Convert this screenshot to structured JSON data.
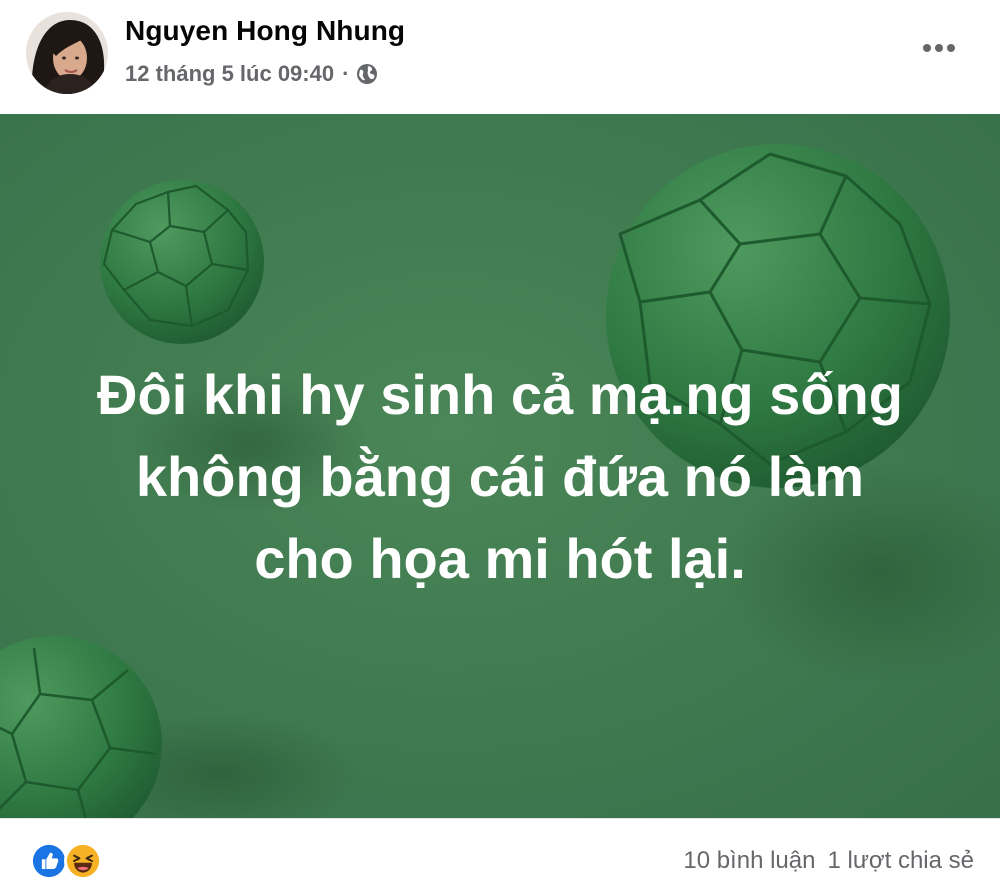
{
  "post": {
    "author": "Nguyen Hong Nhung",
    "timestamp": "12 tháng 5 lúc 09:40",
    "separator": "·",
    "audience_icon": "globe-icon",
    "more_icon": "more-options-icon",
    "image_text_lines": [
      "Đôi khi hy sinh cả mạ.ng sống",
      "không bằng cái đứa nó làm",
      "cho họa mi hót lại."
    ],
    "image_background_color": "#3f7a4e"
  },
  "footer": {
    "reaction_icons": [
      "like-icon",
      "haha-icon"
    ],
    "comments": "10 bình luận",
    "shares": "1 lượt chia sẻ"
  },
  "colors": {
    "name": "#050505",
    "secondary": "#65676b",
    "like_blue": "#1b74e4",
    "haha_yellow": "#f7b125"
  }
}
